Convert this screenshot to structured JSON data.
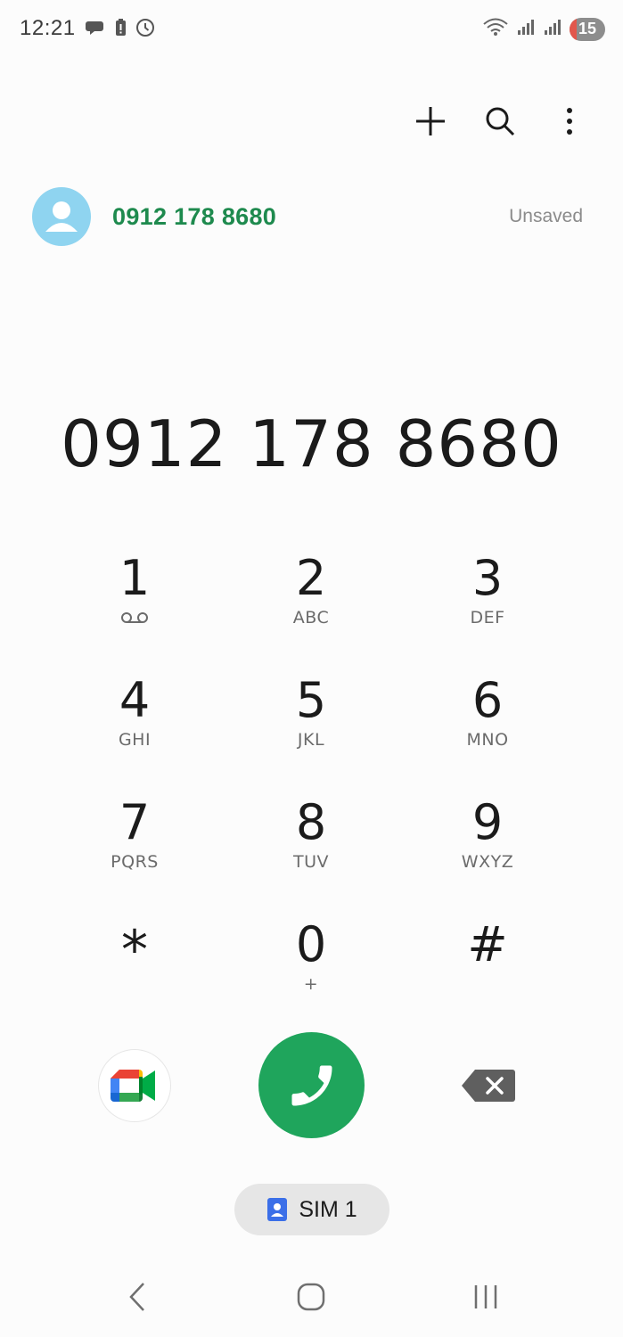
{
  "status_bar": {
    "time": "12:21",
    "battery_level": "15",
    "icons_left": [
      "chat-bubble-icon",
      "alert-battery-icon",
      "clock-icon"
    ],
    "icons_right": [
      "wifi-icon",
      "signal-icon",
      "signal-icon",
      "battery-icon"
    ]
  },
  "action_bar": {
    "icons": [
      "plus-icon",
      "search-icon",
      "more-vert-icon"
    ]
  },
  "suggestion": {
    "number": "0912 178 8680",
    "status": "Unsaved"
  },
  "dialed_number": "0912 178 8680",
  "keypad": {
    "keys": [
      {
        "digit": "1",
        "letters": ""
      },
      {
        "digit": "2",
        "letters": "ABC"
      },
      {
        "digit": "3",
        "letters": "DEF"
      },
      {
        "digit": "4",
        "letters": "GHI"
      },
      {
        "digit": "5",
        "letters": "JKL"
      },
      {
        "digit": "6",
        "letters": "MNO"
      },
      {
        "digit": "7",
        "letters": "PQRS"
      },
      {
        "digit": "8",
        "letters": "TUV"
      },
      {
        "digit": "9",
        "letters": "WXYZ"
      },
      {
        "digit": "*",
        "letters": ""
      },
      {
        "digit": "0",
        "letters": "+"
      },
      {
        "digit": "#",
        "letters": ""
      }
    ]
  },
  "sim": {
    "label": "SIM 1"
  },
  "colors": {
    "accent_green": "#1fa55c",
    "suggest_green": "#1e8a4e",
    "avatar_blue": "#8fd4f0",
    "sim_blue": "#3b6fe8"
  }
}
